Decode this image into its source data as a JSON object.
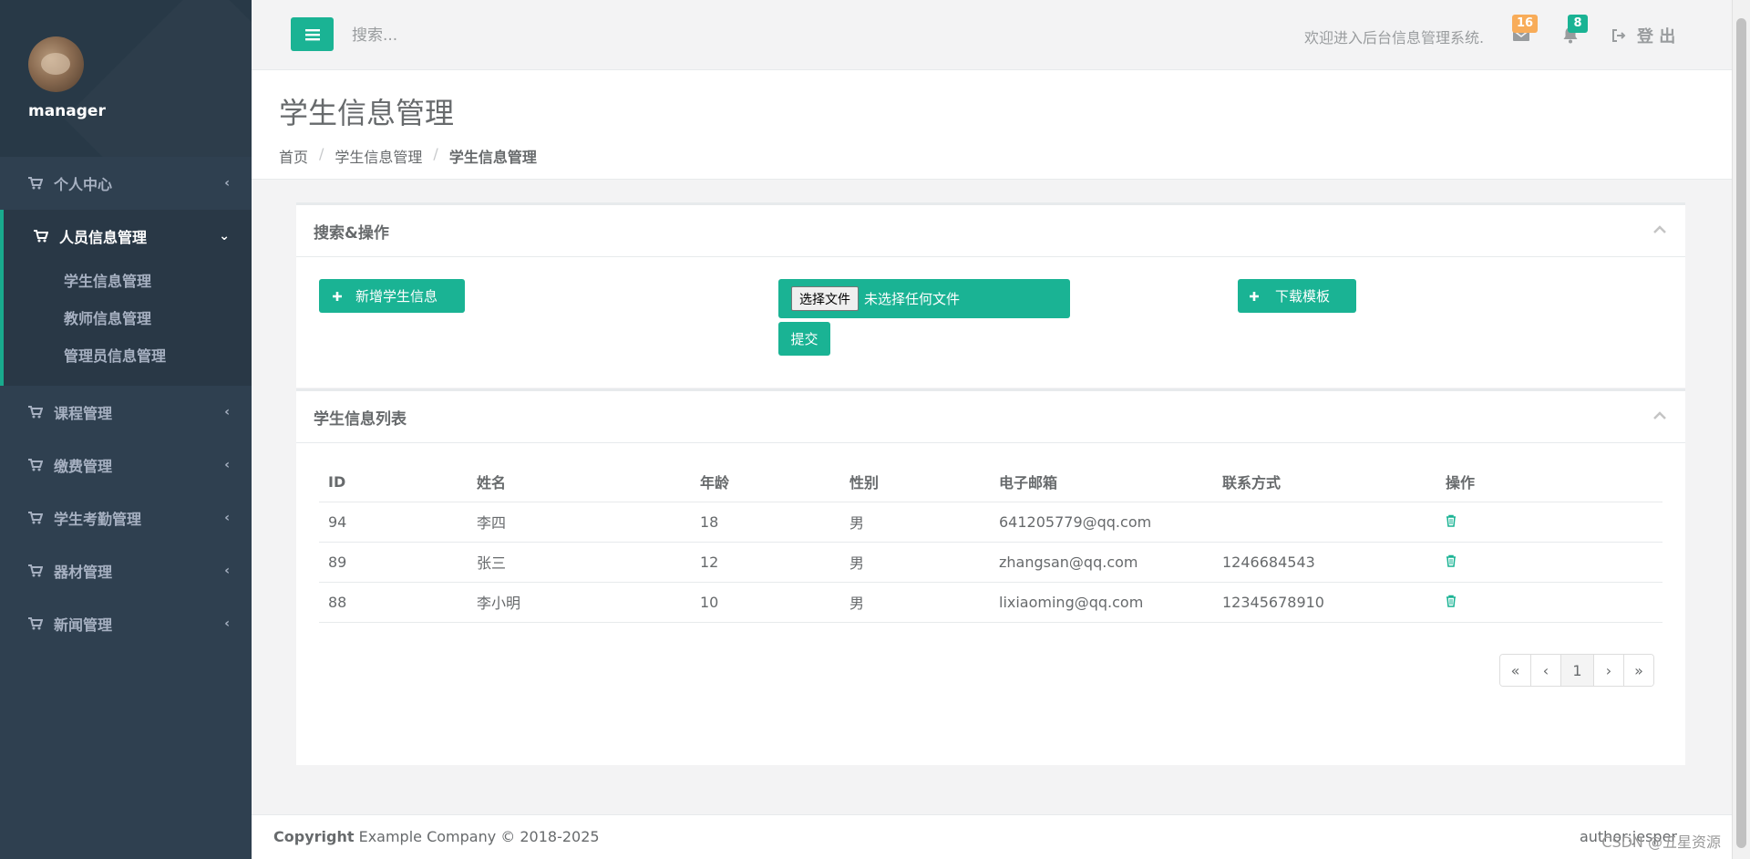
{
  "sidebar": {
    "username": "manager",
    "menu": [
      {
        "label": "个人中心",
        "caret": "‹"
      },
      {
        "label": "人员信息管理",
        "caret": "⌄",
        "children": [
          "学生信息管理",
          "教师信息管理",
          "管理员信息管理"
        ]
      },
      {
        "label": "课程管理",
        "caret": "‹"
      },
      {
        "label": "缴费管理",
        "caret": "‹"
      },
      {
        "label": "学生考勤管理",
        "caret": "‹"
      },
      {
        "label": "器材管理",
        "caret": "‹"
      },
      {
        "label": "新闻管理",
        "caret": "‹"
      }
    ]
  },
  "topbar": {
    "search_placeholder": "搜索...",
    "welcome": "欢迎进入后台信息管理系统.",
    "mail_count": "16",
    "bell_count": "8",
    "logout_label": "登 出",
    "colors": {
      "mail_badge": "#f8ac59",
      "bell_badge": "#1ab394"
    }
  },
  "heading": {
    "title": "学生信息管理",
    "breadcrumb": [
      "首页",
      "学生信息管理",
      "学生信息管理"
    ]
  },
  "search_panel": {
    "title": "搜索&操作",
    "add_button": "新增学生信息",
    "file_button": "选择文件",
    "file_status": "未选择任何文件",
    "submit_button": "提交",
    "template_button": "下载模板"
  },
  "list_panel": {
    "title": "学生信息列表",
    "columns": [
      "ID",
      "姓名",
      "年龄",
      "性别",
      "电子邮箱",
      "联系方式",
      "操作"
    ],
    "rows": [
      [
        "94",
        "李四",
        "18",
        "男",
        "641205779@qq.com",
        ""
      ],
      [
        "89",
        "张三",
        "12",
        "男",
        "zhangsan@qq.com",
        "1246684543"
      ],
      [
        "88",
        "李小明",
        "10",
        "男",
        "lixiaoming@qq.com",
        "12345678910"
      ]
    ],
    "pager": [
      "«",
      "‹",
      "1",
      "›",
      "»"
    ]
  },
  "footer": {
    "copyright_bold": "Copyright",
    "copyright_text": "Example Company © 2018-2025",
    "author": "author:jesper",
    "watermark": "CSDN @五星资源"
  },
  "colors": {
    "accent": "#1ab394",
    "sidebar": "#2f4050"
  }
}
